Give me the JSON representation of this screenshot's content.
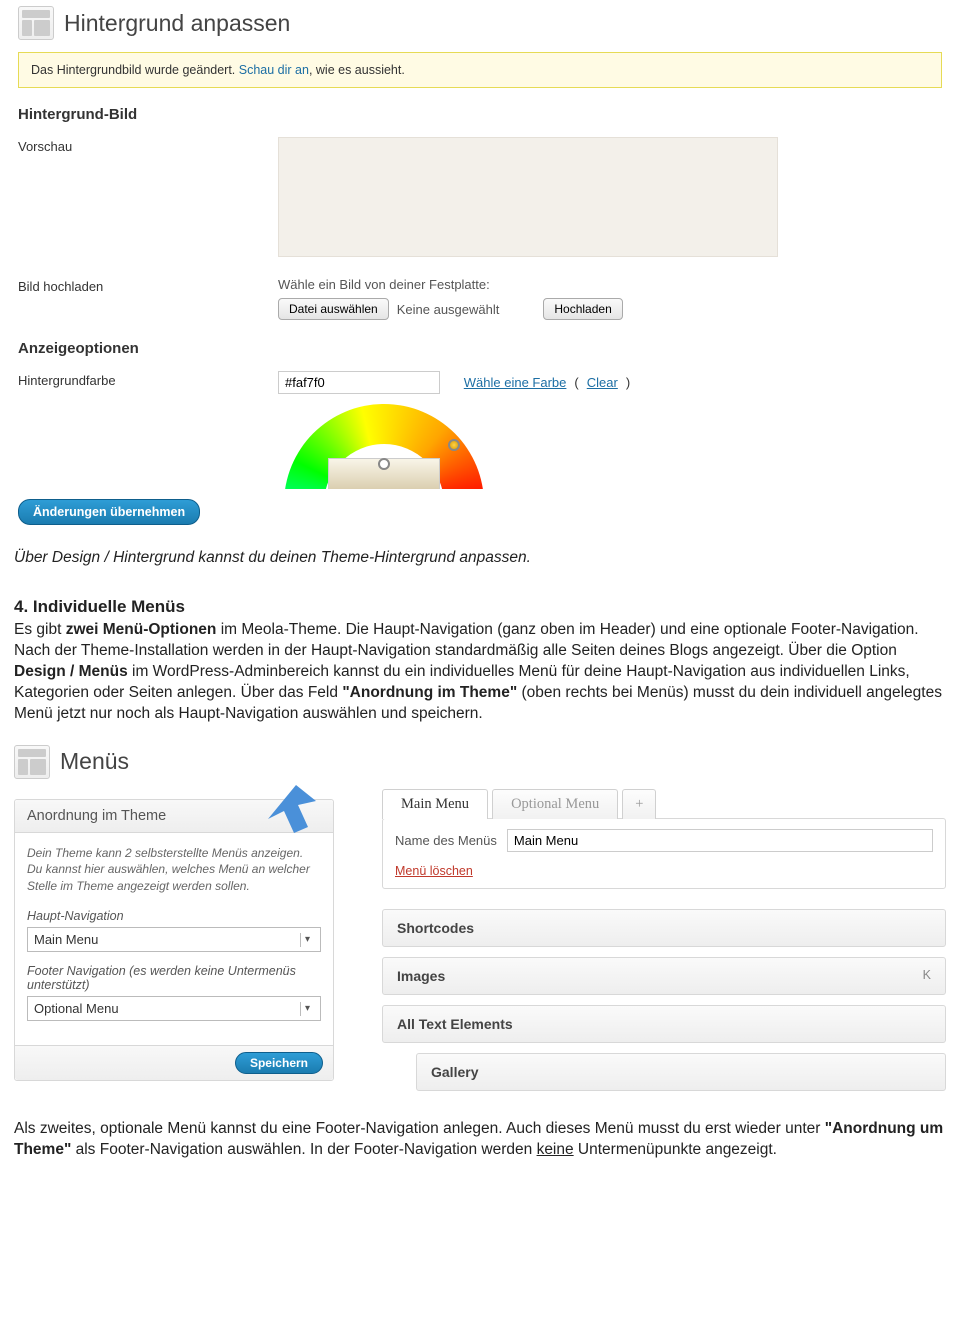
{
  "bg_admin": {
    "title": "Hintergrund anpassen",
    "notice_prefix": "Das Hintergrundbild wurde geändert. ",
    "notice_link": "Schau dir an",
    "notice_suffix": ", wie es aussieht.",
    "section_bild": "Hintergrund-Bild",
    "row_vorschau": "Vorschau",
    "row_upload": "Bild hochladen",
    "upload_prompt": "Wähle ein Bild von deiner Festplatte:",
    "btn_choose": "Datei auswählen",
    "no_file": "Keine ausgewählt",
    "btn_upload": "Hochladen",
    "section_anzeige": "Anzeigeoptionen",
    "row_color": "Hintergrundfarbe",
    "color_value": "#faf7f0",
    "link_pick": "Wähle eine Farbe",
    "link_clear": "Clear",
    "btn_save": "Änderungen übernehmen"
  },
  "caption1": "Über Design / Hintergrund kannst du deinen Theme-Hintergrund anpassen.",
  "section4": {
    "heading": "4. Individuelle Menüs",
    "p1a": "Es gibt ",
    "p1b": "zwei Menü-Optionen",
    "p1c": " im Meola-Theme. Die Haupt-Navigation (ganz oben im Header) und eine optionale Footer-Navigation. Nach der Theme-Installation werden in der Haupt-Navigation standardmäßig alle Seiten deines Blogs angezeigt. Über die Option ",
    "p1d": "Design / Menüs",
    "p1e": " im WordPress-Adminbereich kannst du ein individuelles Menü für deine Haupt-Navigation aus individuellen Links, Kategorien oder Seiten anlegen. Über das Feld ",
    "p1f": "\"Anordnung im Theme\"",
    "p1g": " (oben rechts bei Menüs) musst du dein individuell angelegtes Menü jetzt nur noch als Haupt-Navigation auswählen und speichern."
  },
  "menus": {
    "title": "Menüs",
    "panel_head": "Anordnung im Theme",
    "panel_desc": "Dein Theme kann 2 selbsterstellte Menüs anzeigen. Du kannst hier auswählen, welches Menü an welcher Stelle im Theme angezeigt werden sollen.",
    "label_haupt": "Haupt-Navigation",
    "sel_haupt": "Main Menu",
    "label_footer": "Footer Navigation (es werden keine Untermenüs unterstützt)",
    "sel_footer": "Optional Menu",
    "btn_save": "Speichern",
    "tab_main": "Main Menu",
    "tab_opt": "Optional Menu",
    "tab_plus": "+",
    "name_label": "Name des Menüs",
    "name_value": "Main Menu",
    "delete": "Menü löschen",
    "items": {
      "i1": "Shortcodes",
      "i2": "Images",
      "i2_meta": "K",
      "i3": "All Text Elements",
      "i4": "Gallery"
    }
  },
  "final": {
    "a": "Als zweites, optionale Menü kannst du eine Footer-Navigation anlegen. Auch dieses Menü musst du erst wieder unter ",
    "b": "\"Anordnung um Theme\"",
    "c": " als Footer-Navigation auswählen. In der Footer-Navigation werden ",
    "d": "keine",
    "e": " Untermenüpunkte angezeigt."
  }
}
